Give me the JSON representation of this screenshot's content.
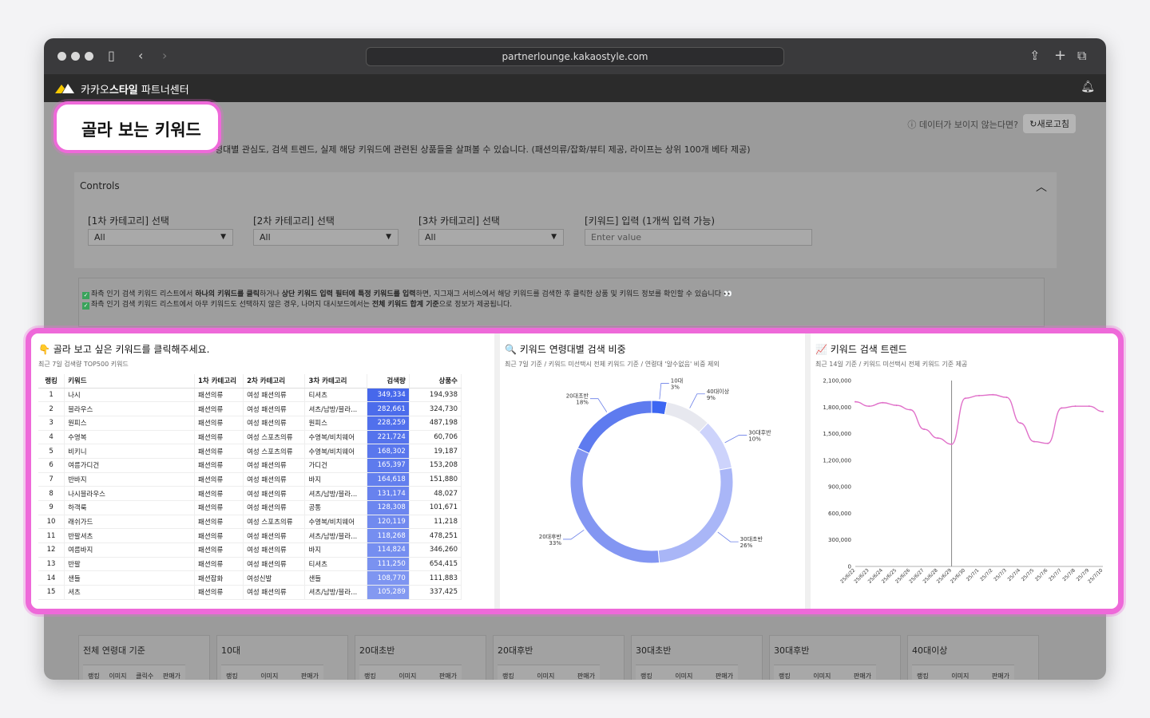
{
  "browser": {
    "url": "partnerlounge.kakaostyle.com"
  },
  "app": {
    "brand_prefix": "카카오",
    "brand_bold": "스타일",
    "brand_suffix": " 파트너센터"
  },
  "callout": {
    "title": "골라 보는 키워드"
  },
  "header": {
    "help_text": "ⓘ 데이터가 보이지 않는다면?",
    "refresh_label": "↻새로고침",
    "description": "령대별 관심도, 검색 트렌드, 실제 해당 키워드에 관련된 상품들을 살펴볼 수 있습니다. (패션의류/잡화/뷰티 제공, 라이프는 상위 100개 베타 제공)"
  },
  "controls": {
    "title": "Controls",
    "filters": [
      {
        "label": "[1차 카테고리] 선택",
        "value": "All"
      },
      {
        "label": "[2차 카테고리] 선택",
        "value": "All"
      },
      {
        "label": "[3차 카테고리] 선택",
        "value": "All"
      }
    ],
    "keyword_label": "[키워드] 입력 (1개씩 입력 가능)",
    "keyword_placeholder": "Enter value"
  },
  "notice": {
    "line1_a": "좌측 인기 검색 키워드 리스트에서 ",
    "line1_b": "하나의 키워드를 클릭",
    "line1_c": "하거나 ",
    "line1_d": "상단 키워드 입력 필터에 특정 키워드를 입력",
    "line1_e": "하면, 지그재그 서비스에서 해당 키워드를 검색한 후 클릭한 상품 및 키워드 정보를 확인할 수 있습니다 👀",
    "line2_a": "좌측 인기 검색 키워드 리스트에서 아무 키워드도 선택하지 않은 경우, 나머지 대시보드에서는 ",
    "line2_b": "전체 키워드 합계 기준",
    "line2_c": "으로 정보가 제공됩니다."
  },
  "keyword_table": {
    "title": "👇 골라 보고 싶은 키워드를 클릭해주세요.",
    "subtitle": "최근 7일 검색량 TOP500 키워드",
    "headers": [
      "랭킹",
      "키워드",
      "1차 카테고리",
      "2차 카테고리",
      "3차 카테고리",
      "검색량",
      "상품수"
    ],
    "rows": [
      [
        "1",
        "나시",
        "패션의류",
        "여성 패션의류",
        "티셔츠",
        "349,334",
        "194,938"
      ],
      [
        "2",
        "블라우스",
        "패션의류",
        "여성 패션의류",
        "셔츠/남방/블라...",
        "282,661",
        "324,730"
      ],
      [
        "3",
        "원피스",
        "패션의류",
        "여성 패션의류",
        "원피스",
        "228,259",
        "487,198"
      ],
      [
        "4",
        "수영복",
        "패션의류",
        "여성 스포츠의류",
        "수영복/비치웨어",
        "221,724",
        "60,706"
      ],
      [
        "5",
        "비키니",
        "패션의류",
        "여성 스포츠의류",
        "수영복/비치웨어",
        "168,302",
        "19,187"
      ],
      [
        "6",
        "여름가디건",
        "패션의류",
        "여성 패션의류",
        "가디건",
        "165,397",
        "153,208"
      ],
      [
        "7",
        "반바지",
        "패션의류",
        "여성 패션의류",
        "바지",
        "164,618",
        "151,880"
      ],
      [
        "8",
        "나시블라우스",
        "패션의류",
        "여성 패션의류",
        "셔츠/남방/블라...",
        "131,174",
        "48,027"
      ],
      [
        "9",
        "하객룩",
        "패션의류",
        "여성 패션의류",
        "공통",
        "128,308",
        "101,671"
      ],
      [
        "10",
        "래쉬가드",
        "패션의류",
        "여성 스포츠의류",
        "수영복/비치웨어",
        "120,119",
        "11,218"
      ],
      [
        "11",
        "반팔셔츠",
        "패션의류",
        "여성 패션의류",
        "셔츠/남방/블라...",
        "118,268",
        "478,251"
      ],
      [
        "12",
        "여름바지",
        "패션의류",
        "여성 패션의류",
        "바지",
        "114,824",
        "346,260"
      ],
      [
        "13",
        "반팔",
        "패션의류",
        "여성 패션의류",
        "티셔츠",
        "111,250",
        "654,415"
      ],
      [
        "14",
        "샌들",
        "패션잡화",
        "여성신발",
        "샌들",
        "108,770",
        "111,883"
      ],
      [
        "15",
        "셔츠",
        "패션의류",
        "여성 패션의류",
        "셔츠/남방/블라...",
        "105,289",
        "337,425"
      ]
    ]
  },
  "age_chart": {
    "title": "🔍 키워드 연령대별 검색 비중",
    "subtitle": "최근 7일 기준 / 키워드 미선택시 전체 키워드 기준 / 연령대 '알수없음' 비중 제외",
    "chart_data": {
      "type": "pie",
      "donut": true,
      "slices": [
        {
          "label": "10대",
          "value": 3,
          "color": "#3c66f2"
        },
        {
          "label": "40대이상",
          "value": 9,
          "color": "#e7e8ef"
        },
        {
          "label": "30대후반",
          "value": 10,
          "color": "#cdd3fb"
        },
        {
          "label": "30대초반",
          "value": 26,
          "color": "#a9b6f7"
        },
        {
          "label": "20대후반",
          "value": 33,
          "color": "#8396f2"
        },
        {
          "label": "20대초반",
          "value": 18,
          "color": "#5e7bef"
        }
      ]
    }
  },
  "trend_chart": {
    "title": "📈 키워드 검색 트렌드",
    "subtitle": "최근 14일 기준 / 키워드 미선택시 전체 키워드 기준 제공",
    "chart_data": {
      "type": "line",
      "x": [
        "25/6/22",
        "25/6/23",
        "25/6/24",
        "25/6/25",
        "25/6/26",
        "25/6/27",
        "25/6/28",
        "25/6/29",
        "25/6/30",
        "25/7/1",
        "25/7/2",
        "25/7/3",
        "25/7/4",
        "25/7/5",
        "25/7/6",
        "25/7/7",
        "25/7/8",
        "25/7/9",
        "25/7/10"
      ],
      "values": [
        1860000,
        1810000,
        1850000,
        1820000,
        1770000,
        1550000,
        1450000,
        1380000,
        1900000,
        1930000,
        1940000,
        1910000,
        1620000,
        1410000,
        1390000,
        1790000,
        1810000,
        1810000,
        1750000
      ],
      "y_ticks": [
        "0",
        "300,000",
        "600,000",
        "900,000",
        "1,200,000",
        "1,500,000",
        "1,800,000",
        "2,100,000"
      ],
      "ylim": [
        0,
        2100000
      ],
      "line_color": "#e070c9",
      "marker_index": 7
    }
  },
  "bottom_cards": {
    "titles": [
      "전체 연령대 기준",
      "10대",
      "20대초반",
      "20대후반",
      "30대초반",
      "30대후반",
      "40대이상"
    ],
    "col_rank": "랭킹",
    "col_image": "이미지",
    "col_clicks": "클릭수",
    "col_sales": "판매가"
  }
}
